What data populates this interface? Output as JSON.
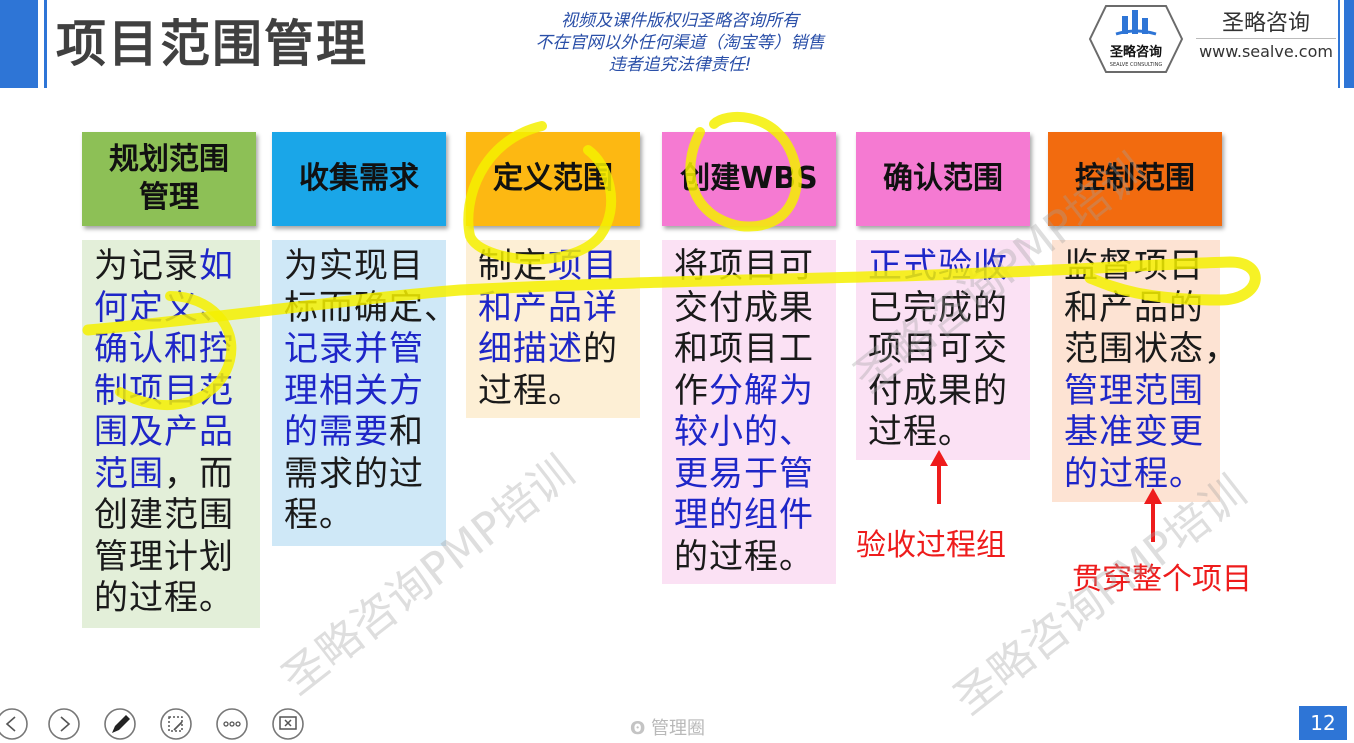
{
  "slide": {
    "title": "项目范围管理",
    "notice": [
      "视频及课件版权归圣略咨询所有",
      "不在官网以外任何渠道（淘宝等）销售",
      "违者追究法律责任!"
    ],
    "brand_name": "圣略咨询",
    "brand_url": "www.sealve.com",
    "logo_text": "圣略咨询",
    "logo_subtext": "SEALVE CONSULTING",
    "watermarks": [
      "圣略咨询PMP培训",
      "圣略咨询PMP培训",
      "圣略咨询PMP培训"
    ],
    "page_number": "12",
    "footer_logo": "管理圈"
  },
  "processes": [
    {
      "header": [
        "规划范围",
        "管理"
      ],
      "header_color": "#8dc056",
      "body_color": "#e3efd9",
      "lines": [
        [
          {
            "t": "为记录"
          },
          {
            "t": "如",
            "hl": true
          }
        ],
        [
          {
            "t": "何定义、",
            "hl": true
          }
        ],
        [
          {
            "t": "确认和控",
            "hl": true
          }
        ],
        [
          {
            "t": "制项目范",
            "hl": true
          }
        ],
        [
          {
            "t": "围及产品",
            "hl": true
          }
        ],
        [
          {
            "t": "范围",
            "hl": true
          },
          {
            "t": "，而"
          }
        ],
        [
          {
            "t": "创建范围"
          }
        ],
        [
          {
            "t": "管理计划"
          }
        ],
        [
          {
            "t": "的过程。"
          }
        ]
      ]
    },
    {
      "header": [
        "收集需求"
      ],
      "header_color": "#1aa6e8",
      "body_color": "#cfe8f7",
      "lines": [
        [
          {
            "t": "为实现目"
          }
        ],
        [
          {
            "t": "标而确定、"
          }
        ],
        [
          {
            "t": "记录并管",
            "hl": true
          }
        ],
        [
          {
            "t": "理相关方",
            "hl": true
          }
        ],
        [
          {
            "t": "的需要",
            "hl": true
          },
          {
            "t": "和"
          }
        ],
        [
          {
            "t": "需求的过"
          }
        ],
        [
          {
            "t": "程。"
          }
        ]
      ]
    },
    {
      "header": [
        "定义范围"
      ],
      "header_color": "#fdb812",
      "body_color": "#fdefd5",
      "lines": [
        [
          {
            "t": "制定"
          },
          {
            "t": "项目",
            "hl": true
          }
        ],
        [
          {
            "t": "和产品详",
            "hl": true
          }
        ],
        [
          {
            "t": "细描述",
            "hl": true
          },
          {
            "t": "的"
          }
        ],
        [
          {
            "t": "过程。"
          }
        ]
      ]
    },
    {
      "header": [
        "创建WBS"
      ],
      "header_color": "#f57ad2",
      "body_color": "#fbe1f4",
      "lines": [
        [
          {
            "t": "将项目可"
          }
        ],
        [
          {
            "t": "交付成果"
          }
        ],
        [
          {
            "t": "和项目工"
          }
        ],
        [
          {
            "t": "作"
          },
          {
            "t": "分解为",
            "hl": true
          }
        ],
        [
          {
            "t": "较小的、",
            "hl": true
          }
        ],
        [
          {
            "t": "更易于管",
            "hl": true
          }
        ],
        [
          {
            "t": "理的组件",
            "hl": true
          }
        ],
        [
          {
            "t": "的过程。"
          }
        ]
      ]
    },
    {
      "header": [
        "确认范围"
      ],
      "header_color": "#f57ad2",
      "body_color": "#fbe1f4",
      "lines": [
        [
          {
            "t": "正式验收",
            "hl": true
          }
        ],
        [
          {
            "t": "已完成的"
          }
        ],
        [
          {
            "t": "项目可交"
          }
        ],
        [
          {
            "t": "付成果的"
          }
        ],
        [
          {
            "t": "过程。"
          }
        ]
      ]
    },
    {
      "header": [
        "控制范围"
      ],
      "header_color": "#f26b0f",
      "body_color": "#fde3d3",
      "lines": [
        [
          {
            "t": "监督项目"
          }
        ],
        [
          {
            "t": "和产品的"
          }
        ],
        [
          {
            "t": "范围状态，"
          }
        ],
        [
          {
            "t": "管理范围",
            "hl": true
          }
        ],
        [
          {
            "t": "基准变更",
            "hl": true
          }
        ],
        [
          {
            "t": "的过程。",
            "hl": true
          }
        ]
      ]
    }
  ],
  "annotations": {
    "validate_note": "验收过程组",
    "control_note": "贯穿整个项目"
  },
  "controls": [
    "previous-slide-icon",
    "next-slide-icon",
    "pen-icon",
    "edit-slide-icon",
    "more-options-icon",
    "exit-slideshow-icon"
  ]
}
